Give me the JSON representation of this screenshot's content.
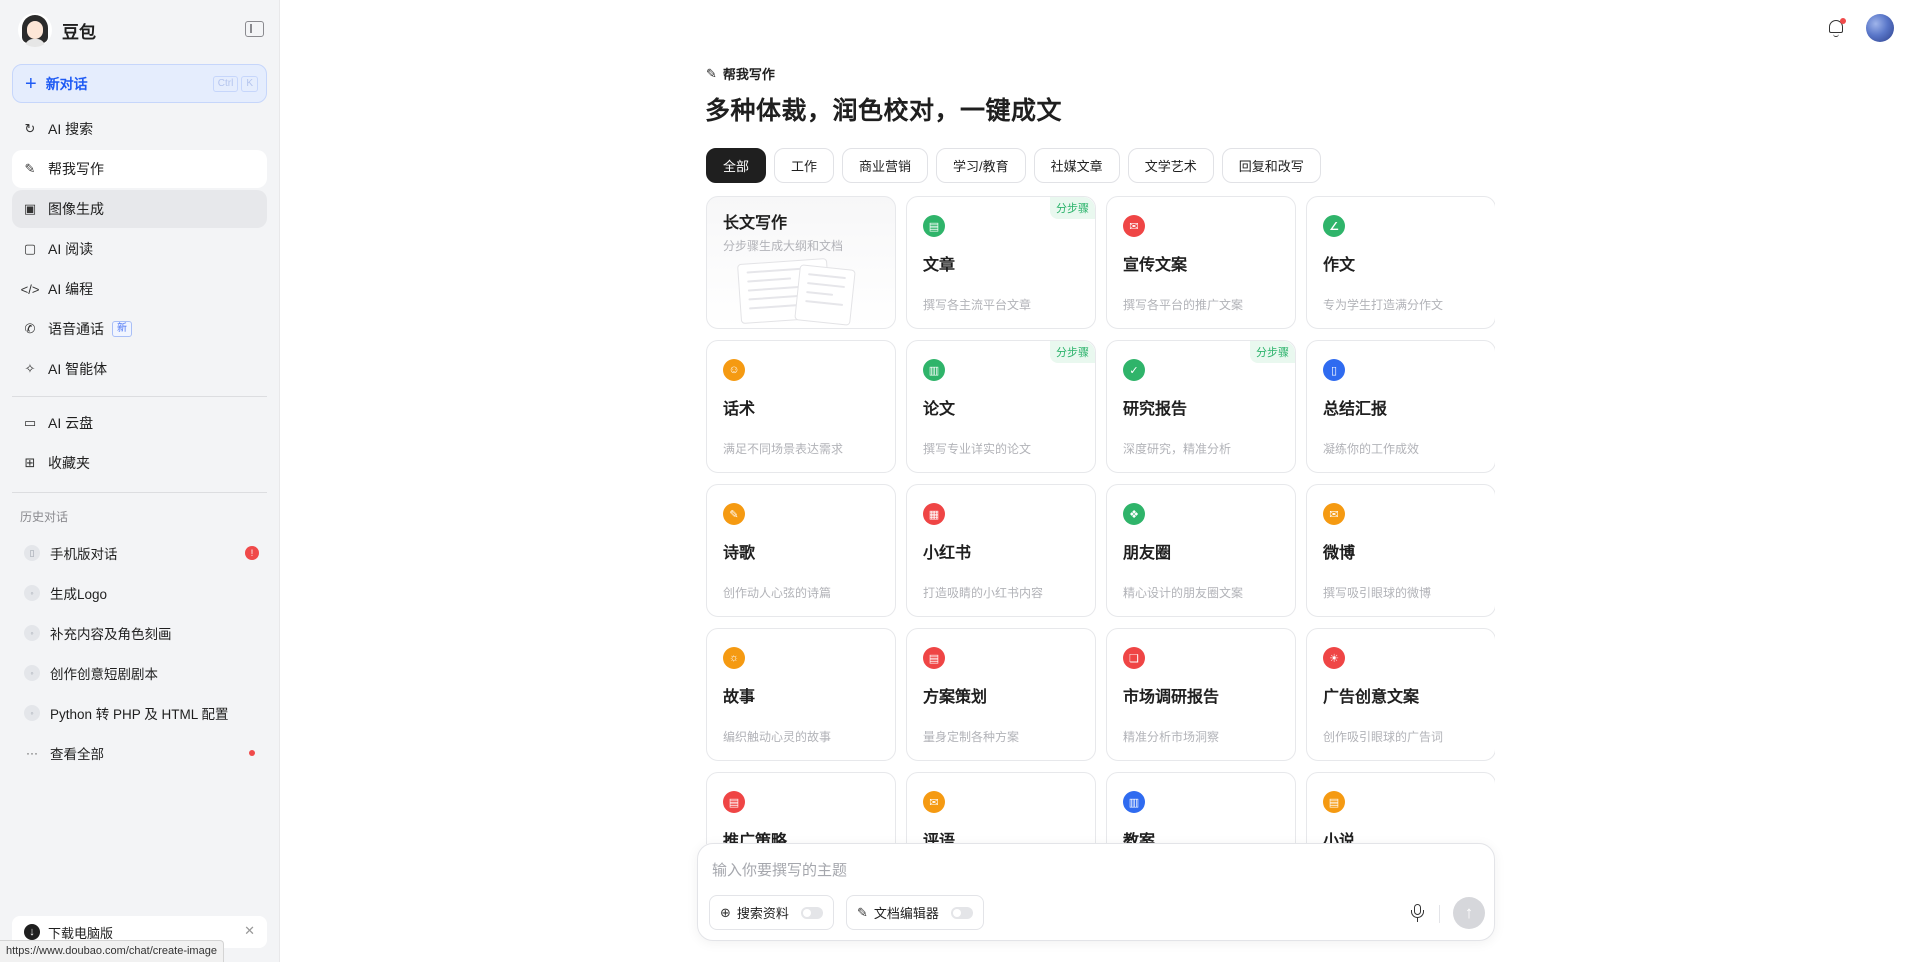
{
  "sidebar": {
    "app_name": "豆包",
    "new_chat": {
      "label": "新对话",
      "shortcut": [
        "Ctrl",
        "K"
      ]
    },
    "nav": [
      {
        "label": "AI 搜索",
        "icon": "search-refresh-icon"
      },
      {
        "label": "帮我写作",
        "icon": "pen-icon",
        "active": true
      },
      {
        "label": "图像生成",
        "icon": "image-icon"
      },
      {
        "label": "AI 阅读",
        "icon": "book-icon"
      },
      {
        "label": "AI 编程",
        "icon": "code-icon"
      },
      {
        "label": "语音通话",
        "icon": "phone-icon",
        "badge": "新"
      },
      {
        "label": "AI 智能体",
        "icon": "sparkle-icon"
      }
    ],
    "nav2": [
      {
        "label": "AI 云盘",
        "icon": "cloud-drive-icon"
      },
      {
        "label": "收藏夹",
        "icon": "bookmark-icon"
      }
    ],
    "history_title": "历史对话",
    "history": [
      {
        "label": "手机版对话",
        "badge": "!"
      },
      {
        "label": "生成Logo"
      },
      {
        "label": "补充内容及角色刻画"
      },
      {
        "label": "创作创意短剧剧本"
      },
      {
        "label": "Python 转 PHP 及 HTML 配置"
      }
    ],
    "view_all": "查看全部",
    "download": "下载电脑版"
  },
  "status_url": "https://www.doubao.com/chat/create-image",
  "main": {
    "tag": "帮我写作",
    "headline": "多种体裁，润色校对，一键成文",
    "tabs": [
      "全部",
      "工作",
      "商业营销",
      "学习/教育",
      "社媒文章",
      "文学艺术",
      "回复和改写"
    ],
    "step_label": "分步骤",
    "cards": [
      {
        "title": "长文写作",
        "desc": "分步骤生成大纲和文档",
        "long": true
      },
      {
        "title": "文章",
        "desc": "撰写各主流平台文章",
        "color": "#2fb46a",
        "step": true
      },
      {
        "title": "宣传文案",
        "desc": "撰写各平台的推广文案",
        "color": "#ef4545"
      },
      {
        "title": "作文",
        "desc": "专为学生打造满分作文",
        "color": "#2fb46a"
      },
      {
        "title": "话术",
        "desc": "满足不同场景表达需求",
        "color": "#f59a12"
      },
      {
        "title": "论文",
        "desc": "撰写专业详实的论文",
        "color": "#2fb46a",
        "step": true
      },
      {
        "title": "研究报告",
        "desc": "深度研究，精准分析",
        "color": "#2fb46a",
        "step": true
      },
      {
        "title": "总结汇报",
        "desc": "凝练你的工作成效",
        "color": "#2f6bf0"
      },
      {
        "title": "诗歌",
        "desc": "创作动人心弦的诗篇",
        "color": "#f59a12"
      },
      {
        "title": "小红书",
        "desc": "打造吸睛的小红书内容",
        "color": "#ef4545"
      },
      {
        "title": "朋友圈",
        "desc": "精心设计的朋友圈文案",
        "color": "#2fb46a"
      },
      {
        "title": "微博",
        "desc": "撰写吸引眼球的微博",
        "color": "#f59a12"
      },
      {
        "title": "故事",
        "desc": "编织触动心灵的故事",
        "color": "#f59a12"
      },
      {
        "title": "方案策划",
        "desc": "量身定制各种方案",
        "color": "#ef4545"
      },
      {
        "title": "市场调研报告",
        "desc": "精准分析市场洞察",
        "color": "#ef4545"
      },
      {
        "title": "广告创意文案",
        "desc": "创作吸引眼球的广告词",
        "color": "#ef4545"
      },
      {
        "title": "推广策略",
        "desc": "",
        "color": "#ef4545"
      },
      {
        "title": "评语",
        "desc": "",
        "color": "#f59a12"
      },
      {
        "title": "教案",
        "desc": "",
        "color": "#2f6bf0"
      },
      {
        "title": "小说",
        "desc": "",
        "color": "#f59a12"
      }
    ]
  },
  "composer": {
    "placeholder": "输入你要撰写的主题",
    "search_toggle": "搜索资料",
    "doc_editor_toggle": "文档编辑器"
  }
}
